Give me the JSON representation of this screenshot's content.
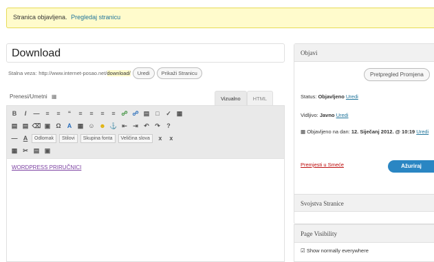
{
  "notice": {
    "text": "Stranica objavljena.",
    "link": "Pregledaj stranicu"
  },
  "title": {
    "value": "Download"
  },
  "permalink": {
    "label": "Stalna veza:",
    "base": "http://www.internet-posao.net/",
    "slug": "download/",
    "edit_button": "Uredi",
    "view_button": "Prikaži Stranicu"
  },
  "editor": {
    "upload_label": "Prenesi/Umetni",
    "tabs": [
      "Vizualno",
      "HTML"
    ],
    "format_select": "Odlomak",
    "style_select": "Stilovi",
    "font_select": "Skupina fonta",
    "size_select": "Veličina slova",
    "content_link": "WORDPRESS PRIRUČNICI"
  },
  "publish": {
    "heading": "Objavi",
    "preview_button": "Pretpregled Promjena",
    "status_label": "Status:",
    "status_value": "Objavljeno",
    "status_edit": "Uredi",
    "visibility_label": "Vidljivo:",
    "visibility_value": "Javno",
    "visibility_edit": "Uredi",
    "published_label": "Objavljeno na dan:",
    "published_date": "12. Siječanj 2012. @ 10:19",
    "published_edit": "Uredi",
    "trash": "Premjesti u Smeće",
    "update_button": "Ažuriraj"
  },
  "page_attributes": {
    "heading": "Svojstva Stranice"
  },
  "page_visibility": {
    "heading": "Page Visibility",
    "option": "Show normally everywhere"
  }
}
